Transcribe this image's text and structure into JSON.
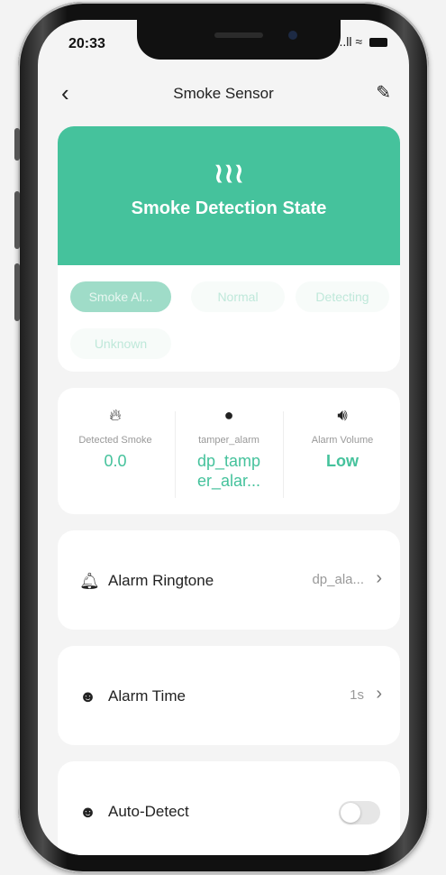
{
  "status_bar": {
    "time": "20:33",
    "signal": "..ll",
    "wifi": "≈"
  },
  "nav": {
    "title": "Smoke Sensor",
    "back_icon": "chevron-left-icon",
    "edit_icon": "edit-pencil-icon"
  },
  "hero": {
    "icon": "smoke-icon",
    "title": "Smoke Detection State",
    "accent": "#45c29c",
    "states": [
      {
        "label": "Smoke Al...",
        "active": true
      },
      {
        "label": "Normal",
        "active": false
      },
      {
        "label": "Detecting",
        "active": false
      },
      {
        "label": "Unknown",
        "active": false
      }
    ]
  },
  "stats": [
    {
      "icon": "flame-icon",
      "label": "Detected Smoke",
      "value": "0.0"
    },
    {
      "icon": "alert-icon",
      "label": "tamper_alarm",
      "value": "dp_tamp er_alar..."
    },
    {
      "icon": "volume-icon",
      "label": "Alarm Volume",
      "value": "Low"
    }
  ],
  "settings": {
    "ringtone": {
      "icon": "bell-icon",
      "label": "Alarm Ringtone",
      "value": "dp_ala..."
    },
    "time": {
      "icon": "face-icon",
      "label": "Alarm Time",
      "value": "1s"
    },
    "auto_detect": {
      "icon": "face-icon",
      "label": "Auto-Detect",
      "enabled": false
    }
  }
}
